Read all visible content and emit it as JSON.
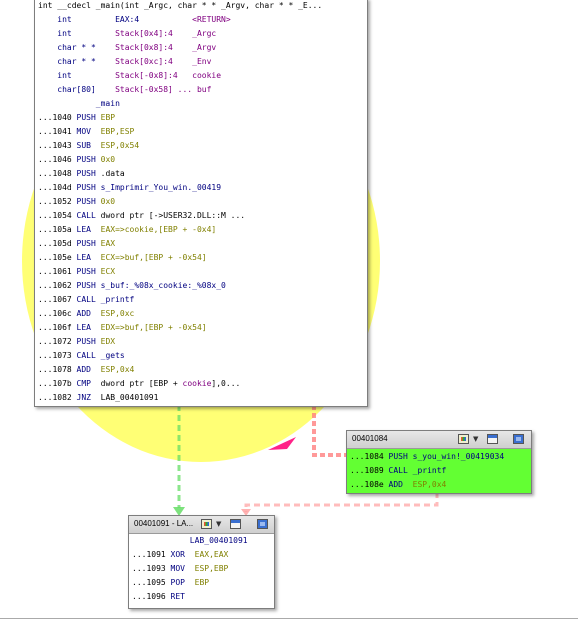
{
  "main_block": {
    "lines": [
      [
        {
          "t": "int __cdecl _main(int _Argc, char * * _Argv, char * * _E...",
          "c": "black"
        }
      ],
      [
        {
          "t": "    int         ",
          "c": "navy"
        },
        {
          "t": "EAX:4           ",
          "c": "navy"
        },
        {
          "t": "<RETURN>",
          "c": "purple"
        }
      ],
      [
        {
          "t": "    int         ",
          "c": "navy"
        },
        {
          "t": "Stack[0x4]:4    ",
          "c": "purple"
        },
        {
          "t": "_Argc",
          "c": "purple"
        }
      ],
      [
        {
          "t": "    char * *    ",
          "c": "navy"
        },
        {
          "t": "Stack[0x8]:4    ",
          "c": "purple"
        },
        {
          "t": "_Argv",
          "c": "purple"
        }
      ],
      [
        {
          "t": "    char * *    ",
          "c": "navy"
        },
        {
          "t": "Stack[0xc]:4    ",
          "c": "purple"
        },
        {
          "t": "_Env",
          "c": "purple"
        }
      ],
      [
        {
          "t": "    int         ",
          "c": "navy"
        },
        {
          "t": "Stack[-0x8]:4   ",
          "c": "purple"
        },
        {
          "t": "cookie",
          "c": "purple"
        }
      ],
      [
        {
          "t": "    char[80]    ",
          "c": "navy"
        },
        {
          "t": "Stack[-0x58] ... ",
          "c": "purple"
        },
        {
          "t": "buf",
          "c": "purple"
        }
      ],
      [
        {
          "t": "            _main",
          "c": "navy"
        }
      ],
      [
        {
          "t": "...1040 ",
          "c": "black"
        },
        {
          "t": "PUSH ",
          "c": "navy"
        },
        {
          "t": "EBP",
          "c": "olive"
        }
      ],
      [
        {
          "t": "...1041 ",
          "c": "black"
        },
        {
          "t": "MOV  ",
          "c": "navy"
        },
        {
          "t": "EBP,ESP",
          "c": "olive"
        }
      ],
      [
        {
          "t": "...1043 ",
          "c": "black"
        },
        {
          "t": "SUB  ",
          "c": "navy"
        },
        {
          "t": "ESP,0x54",
          "c": "olive"
        }
      ],
      [
        {
          "t": "...1046 ",
          "c": "black"
        },
        {
          "t": "PUSH ",
          "c": "navy"
        },
        {
          "t": "0x0",
          "c": "olive"
        }
      ],
      [
        {
          "t": "...1048 ",
          "c": "black"
        },
        {
          "t": "PUSH ",
          "c": "navy"
        },
        {
          "t": ".data",
          "c": "black"
        }
      ],
      [
        {
          "t": "...104d ",
          "c": "black"
        },
        {
          "t": "PUSH ",
          "c": "navy"
        },
        {
          "t": "s_Imprimir_You_win._00419",
          "c": "navy"
        }
      ],
      [
        {
          "t": "...1052 ",
          "c": "black"
        },
        {
          "t": "PUSH ",
          "c": "navy"
        },
        {
          "t": "0x0",
          "c": "olive"
        }
      ],
      [
        {
          "t": "...1054 ",
          "c": "black"
        },
        {
          "t": "CALL ",
          "c": "navy"
        },
        {
          "t": "dword ptr [->USER32.DLL::M ...",
          "c": "black"
        }
      ],
      [
        {
          "t": "...105a ",
          "c": "black"
        },
        {
          "t": "LEA  ",
          "c": "navy"
        },
        {
          "t": "EAX=>cookie",
          "c": "olive"
        },
        {
          "t": ",[EBP + -0x4]",
          "c": "olive"
        }
      ],
      [
        {
          "t": "...105d ",
          "c": "black"
        },
        {
          "t": "PUSH ",
          "c": "navy"
        },
        {
          "t": "EAX",
          "c": "olive"
        }
      ],
      [
        {
          "t": "...105e ",
          "c": "black"
        },
        {
          "t": "LEA  ",
          "c": "navy"
        },
        {
          "t": "ECX=>buf,[EBP + -0x54]",
          "c": "olive"
        }
      ],
      [
        {
          "t": "...1061 ",
          "c": "black"
        },
        {
          "t": "PUSH ",
          "c": "navy"
        },
        {
          "t": "ECX",
          "c": "olive"
        }
      ],
      [
        {
          "t": "...1062 ",
          "c": "black"
        },
        {
          "t": "PUSH ",
          "c": "navy"
        },
        {
          "t": "s_buf:_%08x_cookie:_%08x_0",
          "c": "navy"
        }
      ],
      [
        {
          "t": "...1067 ",
          "c": "black"
        },
        {
          "t": "CALL ",
          "c": "navy"
        },
        {
          "t": "_printf",
          "c": "navy"
        }
      ],
      [
        {
          "t": "...106c ",
          "c": "black"
        },
        {
          "t": "ADD  ",
          "c": "navy"
        },
        {
          "t": "ESP,0xc",
          "c": "olive"
        }
      ],
      [
        {
          "t": "...106f ",
          "c": "black"
        },
        {
          "t": "LEA  ",
          "c": "navy"
        },
        {
          "t": "EDX=>buf,[EBP + -0x54]",
          "c": "olive"
        }
      ],
      [
        {
          "t": "...1072 ",
          "c": "black"
        },
        {
          "t": "PUSH ",
          "c": "navy"
        },
        {
          "t": "EDX",
          "c": "olive"
        }
      ],
      [
        {
          "t": "...1073 ",
          "c": "black"
        },
        {
          "t": "CALL ",
          "c": "navy"
        },
        {
          "t": "_gets",
          "c": "navy"
        }
      ],
      [
        {
          "t": "...1078 ",
          "c": "black"
        },
        {
          "t": "ADD  ",
          "c": "navy"
        },
        {
          "t": "ESP,0x4",
          "c": "olive"
        }
      ],
      [
        {
          "t": "...107b ",
          "c": "black"
        },
        {
          "t": "CMP  ",
          "c": "navy"
        },
        {
          "t": "dword ptr [EBP + ",
          "c": "black"
        },
        {
          "t": "cookie",
          "c": "purple"
        },
        {
          "t": "],0...",
          "c": "black"
        }
      ],
      [
        {
          "t": "...1082 ",
          "c": "black"
        },
        {
          "t": "JNZ  ",
          "c": "navy"
        },
        {
          "t": "LAB_00401091",
          "c": "black"
        }
      ]
    ]
  },
  "win_block": {
    "title": "00401084",
    "lines": [
      [
        {
          "t": "...1084 ",
          "c": "black"
        },
        {
          "t": "PUSH ",
          "c": "navy"
        },
        {
          "t": "s_you_win!_00419034",
          "c": "navy"
        }
      ],
      [
        {
          "t": "...1089 ",
          "c": "black"
        },
        {
          "t": "CALL ",
          "c": "navy"
        },
        {
          "t": "_printf",
          "c": "navy"
        }
      ],
      [
        {
          "t": "...108e ",
          "c": "black"
        },
        {
          "t": "ADD  ",
          "c": "navy"
        },
        {
          "t": "ESP,0x4",
          "c": "olive"
        }
      ]
    ]
  },
  "end_block": {
    "title": "00401091 - LA...",
    "lines": [
      [
        {
          "t": "            LAB_00401091",
          "c": "navy"
        }
      ],
      [
        {
          "t": "...1091 ",
          "c": "black"
        },
        {
          "t": "XOR  ",
          "c": "navy"
        },
        {
          "t": "EAX,EAX",
          "c": "olive"
        }
      ],
      [
        {
          "t": "...1093 ",
          "c": "black"
        },
        {
          "t": "MOV  ",
          "c": "navy"
        },
        {
          "t": "ESP,EBP",
          "c": "olive"
        }
      ],
      [
        {
          "t": "...1095 ",
          "c": "black"
        },
        {
          "t": "POP  ",
          "c": "navy"
        },
        {
          "t": "EBP",
          "c": "olive"
        }
      ],
      [
        {
          "t": "...1096 ",
          "c": "black"
        },
        {
          "t": "RET",
          "c": "navy"
        }
      ]
    ]
  },
  "colors": {
    "highlight": "#ffff66",
    "win_block_bg": "#63ff33",
    "true_edge": "#66dd66",
    "false_edge": "#ff7f7f",
    "cursor_arrow": "#ff2288"
  },
  "icons": {
    "palette": "color-palette-icon",
    "dropdown": "caret-down-icon",
    "window": "restore-window-icon",
    "group": "group-icon"
  }
}
